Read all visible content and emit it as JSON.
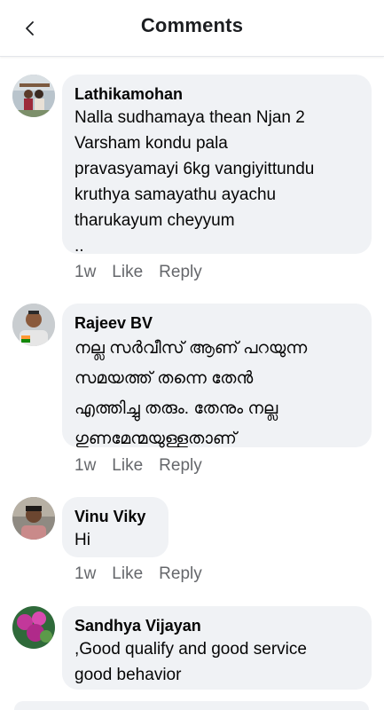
{
  "header": {
    "title": "Comments"
  },
  "comments": [
    {
      "author": "Lathikamohan",
      "text": "Nalla sudhamaya thean Njan 2\nVarsham kondu  pala\npravasyamayi  6kg  vangiyittundu\nkruthya samayathu ayachu\ntharukayum cheyyum\n..",
      "time": "1w",
      "like": "Like",
      "reply": "Reply"
    },
    {
      "author": "Rajeev BV",
      "text": "നല്ല സർവീസ് ആണ് പറയുന്ന\nസമയത്ത് തന്നെ തേൻ\nഎത്തിച്ചു തരും. തേനും നല്ല\nഗുണമേന്മയുള്ളതാണ്",
      "time": "1w",
      "like": "Like",
      "reply": "Reply"
    },
    {
      "author": "Vinu Viky",
      "text": "Hi",
      "time": "1w",
      "like": "Like",
      "reply": "Reply"
    },
    {
      "author": "Sandhya Vijayan",
      "text": ",Good qualify and good service\ngood behavior",
      "time": "",
      "like": "",
      "reply": ""
    }
  ],
  "colors": {
    "bubble": "#f0f2f5",
    "meta": "#65676b",
    "text": "#050505"
  }
}
